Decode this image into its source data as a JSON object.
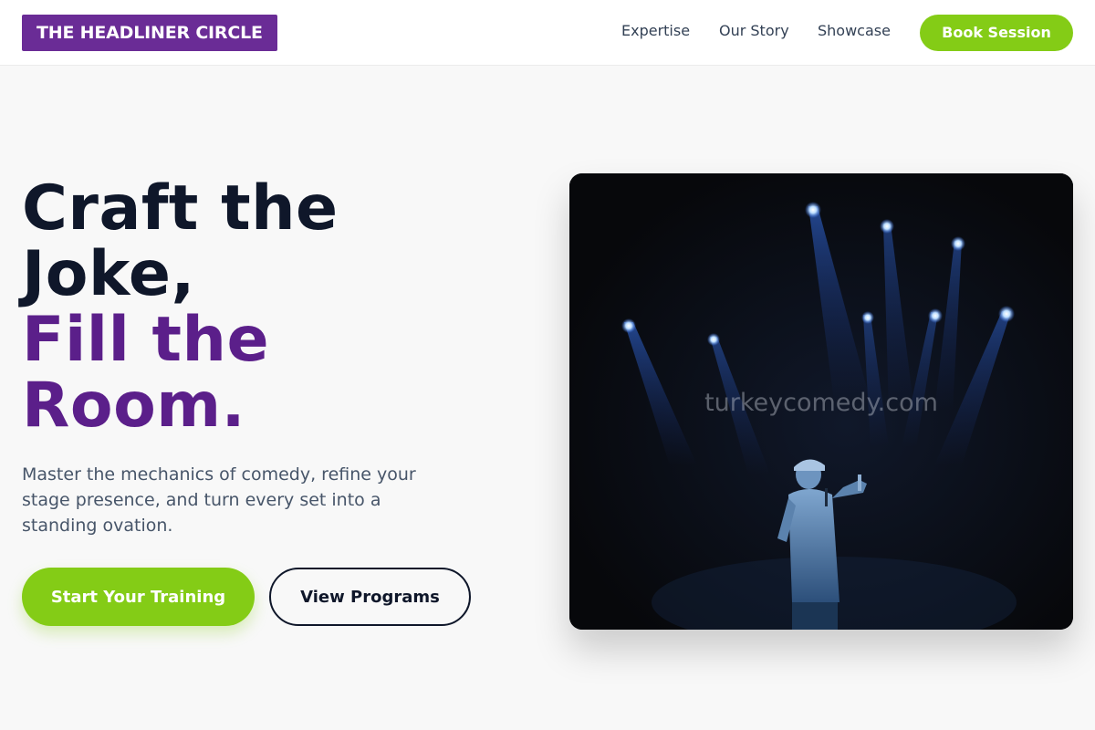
{
  "header": {
    "logo": "THE HEADLINER CIRCLE",
    "nav": {
      "expertise": "Expertise",
      "story": "Our Story",
      "showcase": "Showcase"
    },
    "cta": "Book Session"
  },
  "hero": {
    "headline_line1": "Craft the",
    "headline_line2": "Joke,",
    "headline_line3": "Fill the",
    "headline_line4": "Room.",
    "subtext": "Master the mechanics of comedy, refine your stage presence, and turn every set into a standing ovation.",
    "primary_button": "Start Your Training",
    "secondary_button": "View Programs",
    "image_watermark": "turkeycomedy.com"
  },
  "colors": {
    "brand_purple": "#6a2c96",
    "accent_purple": "#5b1f8a",
    "lime": "#84cc16",
    "ink": "#0f172a"
  }
}
